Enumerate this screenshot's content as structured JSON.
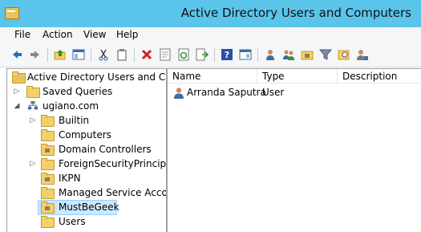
{
  "window": {
    "title": "Active Directory Users and Computers"
  },
  "menu": [
    "File",
    "Action",
    "View",
    "Help"
  ],
  "toolbar": [
    "back-icon",
    "forward-icon",
    "up-folder-icon",
    "show-tree-icon",
    "cut-icon",
    "copy-icon",
    "delete-icon",
    "properties-icon",
    "refresh-icon",
    "export-list-icon",
    "help-icon",
    "console-icon",
    "new-user-icon",
    "new-group-icon",
    "new-ou-icon",
    "filter-icon",
    "find-icon",
    "delegate-icon"
  ],
  "tree": {
    "root": "Active Directory Users and Com",
    "items": [
      {
        "label": "Saved Queries"
      },
      {
        "label": "ugiano.com"
      },
      {
        "label": "Builtin"
      },
      {
        "label": "Computers"
      },
      {
        "label": "Domain Controllers"
      },
      {
        "label": "ForeignSecurityPrincipals"
      },
      {
        "label": "IKPN"
      },
      {
        "label": "Managed Service Accour"
      },
      {
        "label": "MustBeGeek"
      },
      {
        "label": "Users"
      }
    ]
  },
  "list": {
    "columns": [
      "Name",
      "Type",
      "Description"
    ],
    "rows": [
      {
        "name": "Arranda Saputra",
        "type": "User",
        "description": ""
      }
    ]
  }
}
